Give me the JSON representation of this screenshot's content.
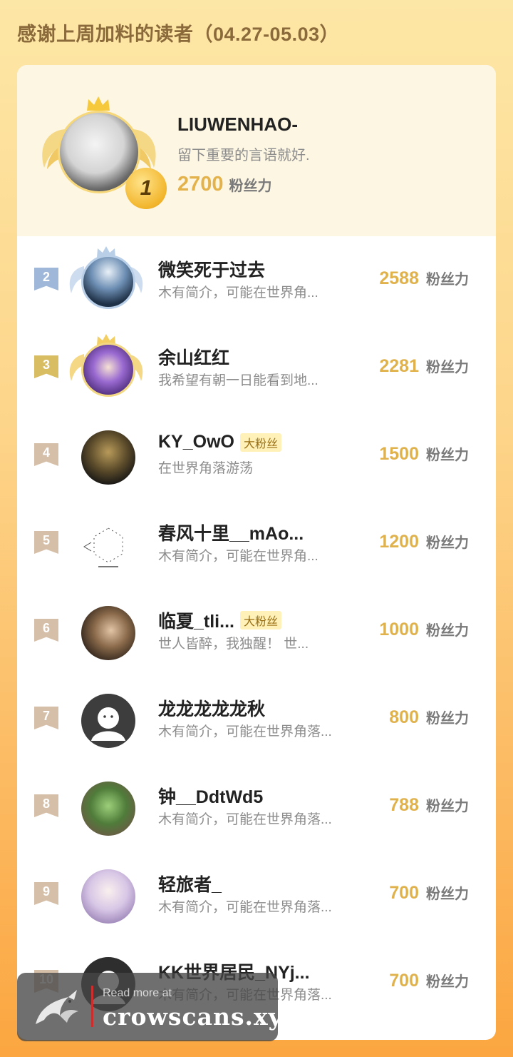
{
  "page_title": "感谢上周加料的读者（04.27-05.03）",
  "fans_unit": "粉丝力",
  "top_reader": {
    "rank": "1",
    "name": "LIUWENHAO-",
    "bio": "留下重要的言语就好.",
    "score": "2700",
    "unit": "粉丝力"
  },
  "readers": [
    {
      "rank": "2",
      "name": "微笑死于过去",
      "bio": "木有简介，可能在世界角...",
      "score": "2588",
      "unit": "粉丝力",
      "badge": "",
      "flag_color": "#9fb8da"
    },
    {
      "rank": "3",
      "name": "余山红红",
      "bio": "我希望有朝一日能看到地...",
      "score": "2281",
      "unit": "粉丝力",
      "badge": "",
      "flag_color": "#d8bd63"
    },
    {
      "rank": "4",
      "name": "KY_OwO",
      "bio": "在世界角落游荡",
      "score": "1500",
      "unit": "粉丝力",
      "badge": "大粉丝",
      "flag_color": "#d6bfa8"
    },
    {
      "rank": "5",
      "name": "春风十里__mAo...",
      "bio": "木有简介，可能在世界角...",
      "score": "1200",
      "unit": "粉丝力",
      "badge": "",
      "flag_color": "#d6bfa8"
    },
    {
      "rank": "6",
      "name": "临夏_tli...",
      "bio": "世人皆醉，我独醒！ 世...",
      "score": "1000",
      "unit": "粉丝力",
      "badge": "大粉丝",
      "flag_color": "#d6bfa8"
    },
    {
      "rank": "7",
      "name": "龙龙龙龙龙秋",
      "bio": "木有简介，可能在世界角落...",
      "score": "800",
      "unit": "粉丝力",
      "badge": "",
      "flag_color": "#d6bfa8"
    },
    {
      "rank": "8",
      "name": "钟__DdtWd5",
      "bio": "木有简介，可能在世界角落...",
      "score": "788",
      "unit": "粉丝力",
      "badge": "",
      "flag_color": "#d6bfa8"
    },
    {
      "rank": "9",
      "name": "轻旅者_",
      "bio": "木有简介，可能在世界角落...",
      "score": "700",
      "unit": "粉丝力",
      "badge": "",
      "flag_color": "#d6bfa8"
    },
    {
      "rank": "10",
      "name": "KK世界居民_NYj...",
      "bio": "木有简介，可能在世界角落...",
      "score": "700",
      "unit": "粉丝力",
      "badge": "",
      "flag_color": "#d6bfa8"
    }
  ],
  "watermark": {
    "read_more": "Read more at",
    "site": "crowscans.xyz"
  }
}
